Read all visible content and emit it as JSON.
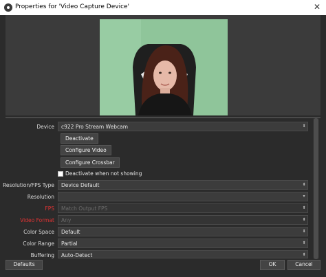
{
  "window": {
    "title": "Properties for 'Video Capture Device'",
    "close_glyph": "✕"
  },
  "preview": {
    "description_icon": "webcam-preview"
  },
  "form": {
    "device": {
      "label": "Device",
      "value": "c922 Pro Stream Webcam"
    },
    "deactivate_label": "Deactivate",
    "configure_video_label": "Configure Video",
    "configure_crossbar_label": "Configure Crossbar",
    "deactivate_checkbox_label": "Deactivate when not showing",
    "deactivate_checked": false,
    "resolution_fps_type": {
      "label": "Resolution/FPS Type",
      "value": "Device Default"
    },
    "resolution": {
      "label": "Resolution",
      "value": ""
    },
    "fps": {
      "label": "FPS",
      "value": "Match Output FPS"
    },
    "video_format": {
      "label": "Video Format",
      "value": "Any"
    },
    "color_space": {
      "label": "Color Space",
      "value": "Default"
    },
    "color_range": {
      "label": "Color Range",
      "value": "Partial"
    },
    "buffering": {
      "label": "Buffering",
      "value": "Auto-Detect"
    }
  },
  "buttons": {
    "defaults": "Defaults",
    "ok": "OK",
    "cancel": "Cancel"
  },
  "colors": {
    "background": "#2b2b2b",
    "error_label": "#e03333",
    "green_screen": "#8fc59a"
  }
}
